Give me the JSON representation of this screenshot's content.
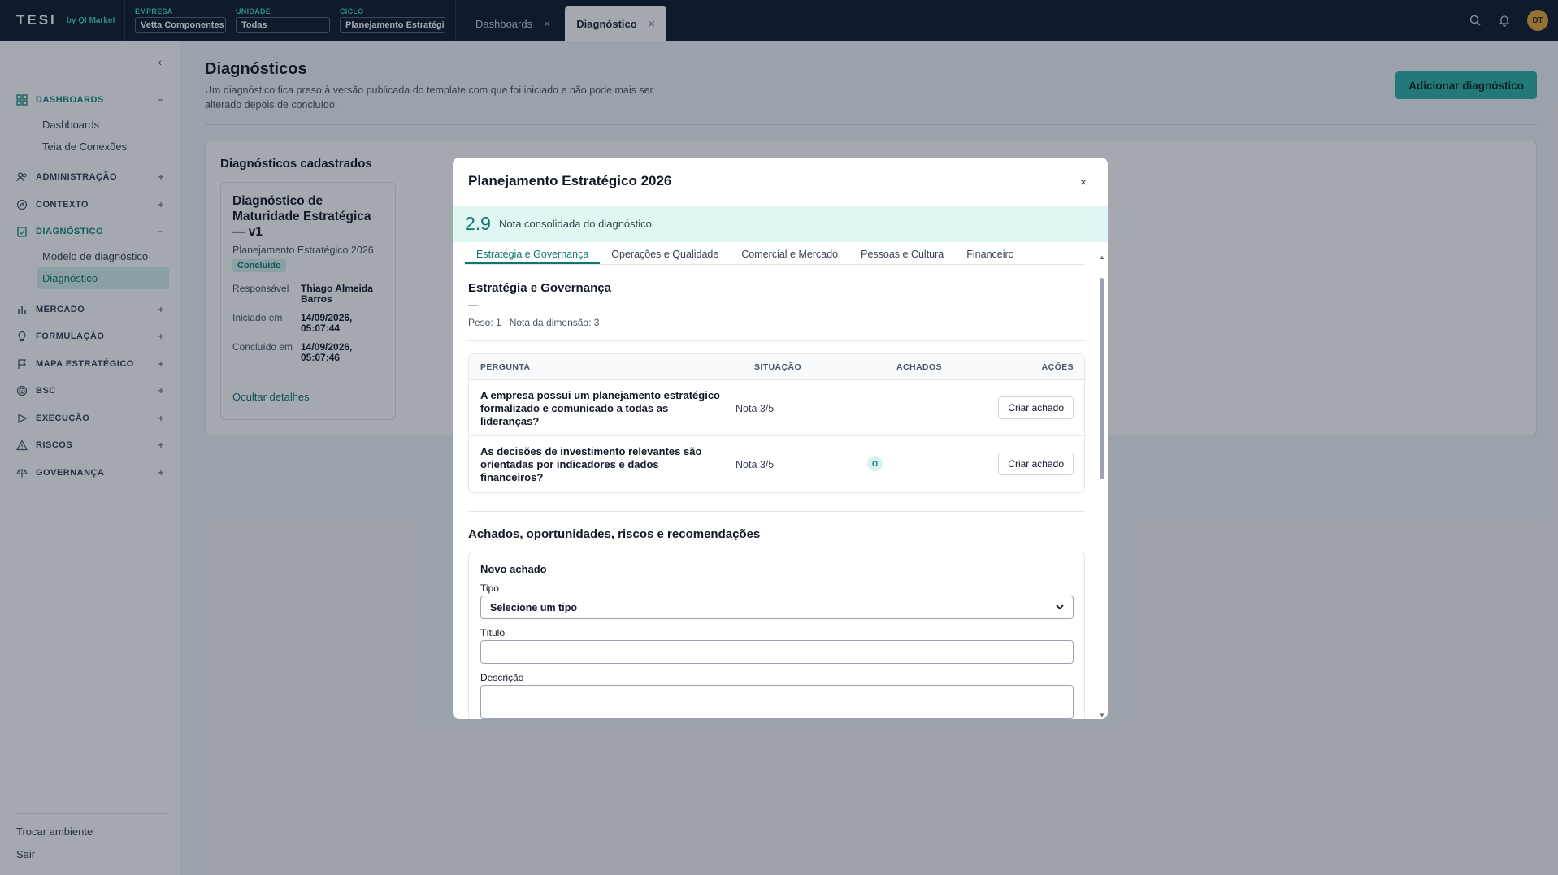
{
  "topbar": {
    "logo": "TESI",
    "logo_sub": "by QI Market",
    "context": [
      {
        "label": "EMPRESA",
        "value": "Vetta Componentes"
      },
      {
        "label": "UNIDADE",
        "value": "Todas"
      },
      {
        "label": "CICLO",
        "value": "Planejamento Estratégi"
      }
    ],
    "tabs": [
      {
        "label": "Dashboards",
        "active": false
      },
      {
        "label": "Diagnóstico",
        "active": true
      }
    ],
    "avatar_initials": "DT",
    "icons": [
      "search-icon",
      "bell-icon"
    ]
  },
  "sidebar": {
    "groups": [
      {
        "label": "DASHBOARDS",
        "sign": "−",
        "icon": "dashboard-icon",
        "open": true,
        "items": [
          {
            "label": "Dashboards"
          },
          {
            "label": "Teia de Conexões"
          }
        ]
      },
      {
        "label": "ADMINISTRAÇÃO",
        "sign": "+",
        "icon": "users-icon"
      },
      {
        "label": "CONTEXTO",
        "sign": "+",
        "icon": "compass-icon"
      },
      {
        "label": "DIAGNÓSTICO",
        "sign": "−",
        "icon": "clipboard-icon",
        "open": true,
        "items": [
          {
            "label": "Modelo de diagnóstico"
          },
          {
            "label": "Diagnóstico",
            "active": true
          }
        ]
      },
      {
        "label": "MERCADO",
        "sign": "+",
        "icon": "bar-chart-icon"
      },
      {
        "label": "FORMULAÇÃO",
        "sign": "+",
        "icon": "lightbulb-icon"
      },
      {
        "label": "MAPA ESTRATÉGICO",
        "sign": "+",
        "icon": "flag-icon"
      },
      {
        "label": "BSC",
        "sign": "+",
        "icon": "target-icon"
      },
      {
        "label": "EXECUÇÃO",
        "sign": "+",
        "icon": "play-icon"
      },
      {
        "label": "RISCOS",
        "sign": "+",
        "icon": "warning-icon"
      },
      {
        "label": "GOVERNANÇA",
        "sign": "+",
        "icon": "scale-icon"
      }
    ],
    "footer": [
      {
        "label": "Trocar ambiente"
      },
      {
        "label": "Sair"
      }
    ]
  },
  "main": {
    "title": "Diagnósticos",
    "subtitle": "Um diagnóstico fica preso à versão publicada do template com que foi iniciado e não pode mais ser alterado depois de concluído.",
    "add_button": "Adicionar diagnóstico",
    "panel_title": "Diagnósticos cadastrados",
    "card": {
      "title": "Diagnóstico de Maturidade Estratégica — v1",
      "cycle": "Planejamento Estratégico 2026",
      "status": "Concluído",
      "fields": [
        {
          "k": "Responsável",
          "v": "Thiago Almeida Barros"
        },
        {
          "k": "Iniciado em",
          "v": "14/09/2026, 05:07:44"
        },
        {
          "k": "Concluído em",
          "v": "14/09/2026, 05:07:46"
        }
      ],
      "link": "Ocultar detalhes"
    }
  },
  "modal": {
    "title": "Planejamento Estratégico 2026",
    "close": "×",
    "score": "2.9",
    "score_label": "Nota consolidada do diagnóstico",
    "tabs": [
      {
        "label": "Estratégia e Governança",
        "active": true
      },
      {
        "label": "Operações e Qualidade"
      },
      {
        "label": "Comercial e Mercado"
      },
      {
        "label": "Pessoas e Cultura"
      },
      {
        "label": "Financeiro"
      }
    ],
    "section_title": "Estratégia e Governança",
    "section_dash": "—",
    "meta": "Peso: 1   Nota da dimensão: 3",
    "table": {
      "headers": [
        "PERGUNTA",
        "SITUAÇÃO",
        "ACHADOS",
        "AÇÕES"
      ],
      "rows": [
        {
          "question": "A empresa possui um planejamento estratégico formalizado e comunicado a todas as lideranças?",
          "situation": "Nota 3/5",
          "findings": "—",
          "action": "Criar achado"
        },
        {
          "question": "As decisões de investimento relevantes são orientadas por indicadores e dados financeiros?",
          "situation": "Nota 3/5",
          "findings": "O",
          "action": "Criar achado"
        }
      ]
    },
    "findings_title": "Achados, oportunidades, riscos e recomendações",
    "form": {
      "title": "Novo achado",
      "type_label": "Tipo",
      "type_value": "Selecione um tipo",
      "title_label": "Título",
      "desc_label": "Descrição"
    }
  }
}
